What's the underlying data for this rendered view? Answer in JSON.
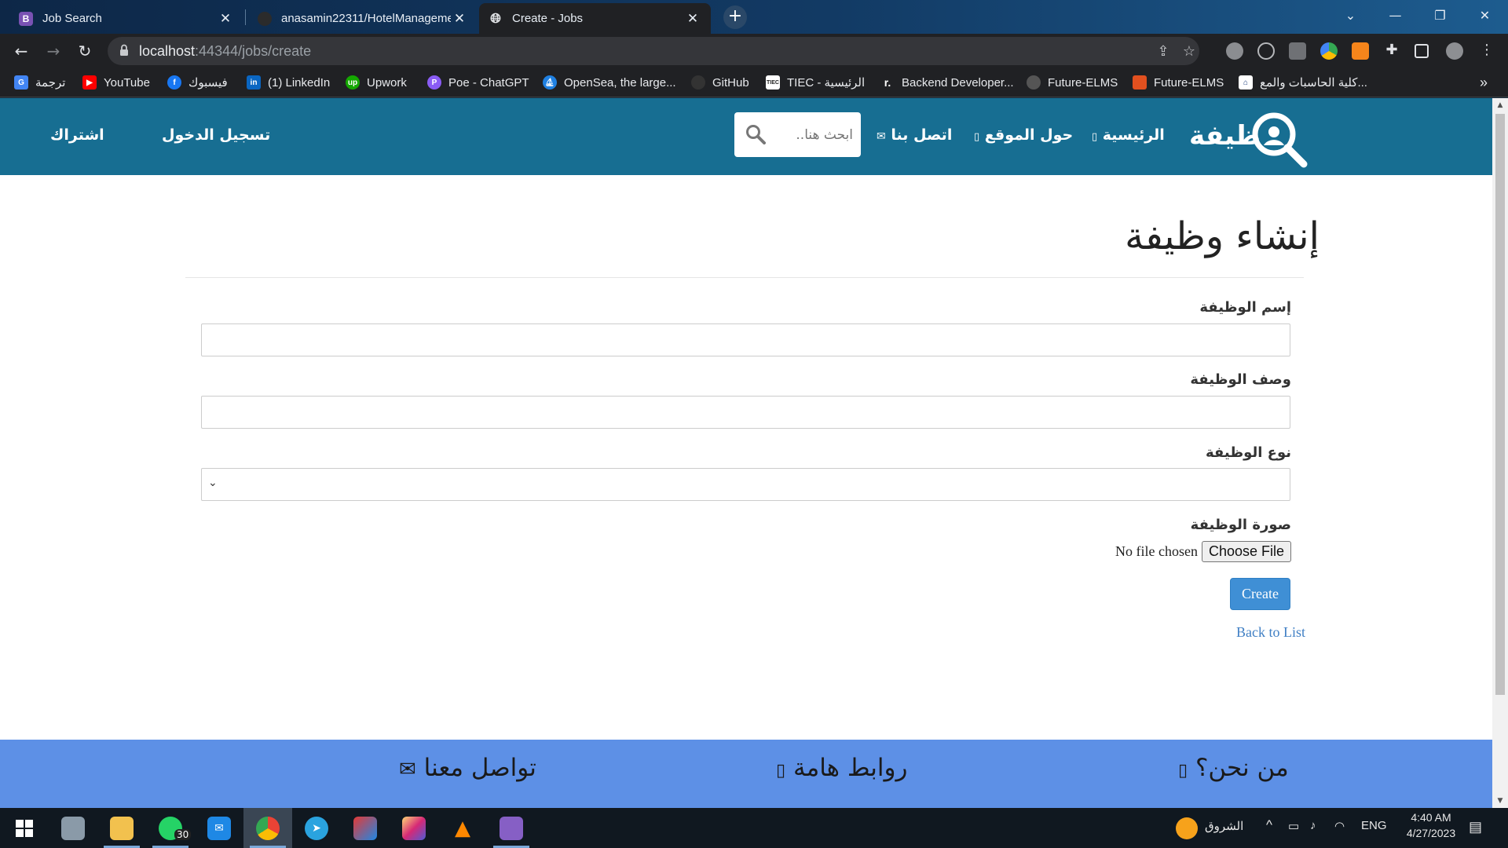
{
  "browser": {
    "tabs": [
      {
        "title": "Job Search",
        "favicon_letter": "B",
        "active": false
      },
      {
        "title": "anasamin22311/HotelManageme",
        "active": false
      },
      {
        "title": "Create - Jobs",
        "active": true
      }
    ],
    "url_host": "localhost",
    "url_rest": ":44344/jobs/create",
    "bookmarks": [
      {
        "label": "ترجمة",
        "icon_color": "#4285f4"
      },
      {
        "label": "YouTube",
        "icon_color": "#ff0000"
      },
      {
        "label": "فيسبوك",
        "icon_color": "#1877f2"
      },
      {
        "label": "(1) LinkedIn",
        "icon_color": "#0a66c2"
      },
      {
        "label": "Upwork",
        "icon_color": "#14a800"
      },
      {
        "label": "Poe - ChatGPT",
        "icon_color": "#8a5cf5"
      },
      {
        "label": "OpenSea, the large...",
        "icon_color": "#2081e2"
      },
      {
        "label": "GitHub",
        "icon_color": "#333333"
      },
      {
        "label": "TIEC - الرئيسية",
        "icon_color": "#ffffff"
      },
      {
        "label": "Backend Developer...",
        "icon_color": "#202124"
      },
      {
        "label": "Future-ELMS",
        "icon_color": "#555555"
      },
      {
        "label": "Future-ELMS",
        "icon_color": "#e2501f"
      },
      {
        "label": "كلية الحاسبات والمع...",
        "icon_color": "#ffffff"
      }
    ],
    "bookmarks_overflow": "»"
  },
  "site": {
    "logo_text": "ظيفة",
    "nav": {
      "home": "الرئيسية",
      "about": "حول الموقع",
      "contact": "اتصل بنا"
    },
    "search_placeholder": "ابحث هنا..",
    "login": "تسجيل الدخول",
    "signup": "اشتراك",
    "colors": {
      "header": "#176e92",
      "footer": "#5d90e6",
      "button": "#3f8fd5"
    }
  },
  "form": {
    "title": "إنشاء وظيفة",
    "job_name_label": "إسم الوظيفة",
    "job_desc_label": "وصف الوظيفة",
    "job_type_label": "نوع الوظيفة",
    "job_image_label": "صورة الوظيفة",
    "no_file": "No file chosen",
    "choose_file": "Choose File",
    "create": "Create",
    "back": "Back to List"
  },
  "footer": {
    "about": "من نحن؟",
    "links": "روابط هامة",
    "contact": "تواصل معنا"
  },
  "taskbar": {
    "whatsapp_badge": "30",
    "weather_label": "الشروق",
    "lang": "ENG",
    "time": "4:40 AM",
    "date": "4/27/2023"
  }
}
